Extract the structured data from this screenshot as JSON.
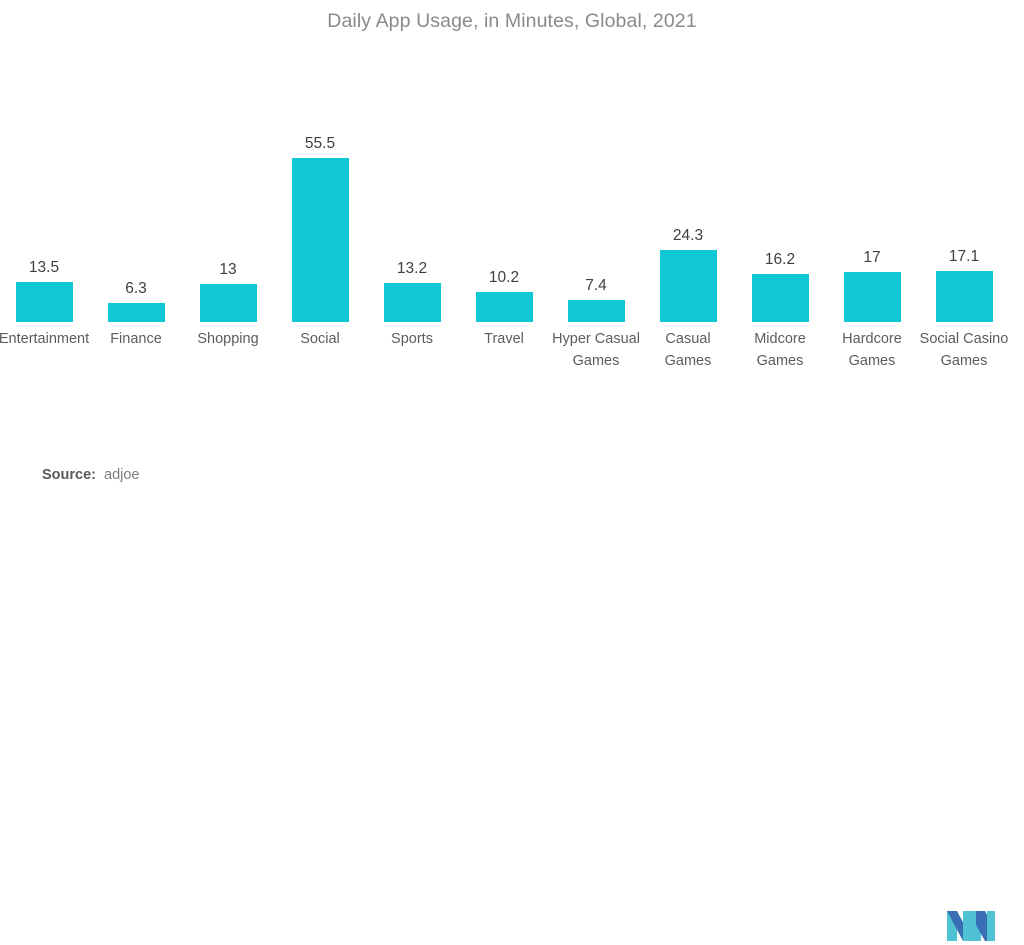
{
  "chart_data": {
    "type": "bar",
    "title": "Daily App Usage, in Minutes, Global, 2021",
    "xlabel": "",
    "ylabel": "",
    "ylim": [
      0,
      60
    ],
    "grid": false,
    "legend": "none",
    "orientation": "vertical",
    "bar_color": "#0fc8d4",
    "categories": [
      "Entertainment",
      "Finance",
      "Shopping",
      "Social",
      "Sports",
      "Travel",
      "Hyper Casual Games",
      "Casual Games",
      "Midcore Games",
      "Hardcore Games",
      "Social Casino Games"
    ],
    "values": [
      13.5,
      6.3,
      13,
      55.5,
      13.2,
      10.2,
      7.4,
      24.3,
      16.2,
      17,
      17.1
    ],
    "value_labels": [
      "13.5",
      "6.3",
      "13",
      "55.5",
      "13.2",
      "10.2",
      "7.4",
      "24.3",
      "16.2",
      "17",
      "17.1"
    ],
    "tick_labels": [
      "Entertainment",
      "Finance",
      "Shopping",
      "Social",
      "Sports",
      "Travel",
      "Hyper Casual Games",
      "Casual Games",
      "Midcore Games",
      "Hardcore Games",
      "Social Casino Games"
    ]
  },
  "footer": {
    "source_label": "Source:",
    "source_value": "adjoe"
  },
  "logo": {
    "name": "mi-logo",
    "color_dark": "#3b6fb5",
    "color_light": "#4fc3d4"
  }
}
